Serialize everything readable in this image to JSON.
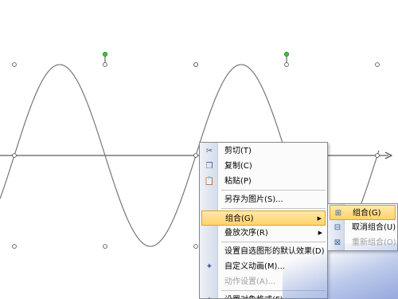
{
  "context_menu": {
    "items": [
      {
        "icon": "scissors-icon",
        "glyph": "✂",
        "label": "剪切(T)",
        "disabled": false
      },
      {
        "icon": "copy-icon",
        "glyph": "❐",
        "label": "复制(C)",
        "disabled": false
      },
      {
        "icon": "paste-icon",
        "glyph": "📋",
        "label": "粘贴(P)",
        "disabled": false
      },
      {
        "icon": "",
        "glyph": "",
        "label": "另存为图片(S)...",
        "disabled": false
      },
      {
        "icon": "",
        "glyph": "",
        "label": "组合(G)",
        "disabled": false,
        "submenu": true,
        "highlighted": true
      },
      {
        "icon": "",
        "glyph": "",
        "label": "叠放次序(R)",
        "disabled": false,
        "submenu": true
      },
      {
        "icon": "",
        "glyph": "",
        "label": "设置自选图形的默认效果(D)",
        "disabled": false
      },
      {
        "icon": "animation-icon",
        "glyph": "✦",
        "label": "自定义动画(M)...",
        "disabled": false
      },
      {
        "icon": "",
        "glyph": "",
        "label": "动作设置(A)...",
        "disabled": true
      },
      {
        "icon": "format-object-icon",
        "glyph": "◈",
        "label": "设置对象格式(F)...",
        "disabled": false
      }
    ]
  },
  "group_submenu": {
    "items": [
      {
        "icon": "group-icon",
        "glyph": "⊞",
        "label": "组合(G)",
        "disabled": false,
        "highlighted": true
      },
      {
        "icon": "ungroup-icon",
        "glyph": "⊟",
        "label": "取消组合(U)",
        "disabled": false
      },
      {
        "icon": "regroup-icon",
        "glyph": "⊠",
        "label": "重新组合(O)",
        "disabled": true
      }
    ]
  },
  "colors": {
    "curve": "#777777",
    "axis": "#333333",
    "handle_fill": "#ffffff",
    "handle_stroke": "#444444",
    "rotate_handle": "#33cc33",
    "menu_highlight": "#ffd36a"
  }
}
